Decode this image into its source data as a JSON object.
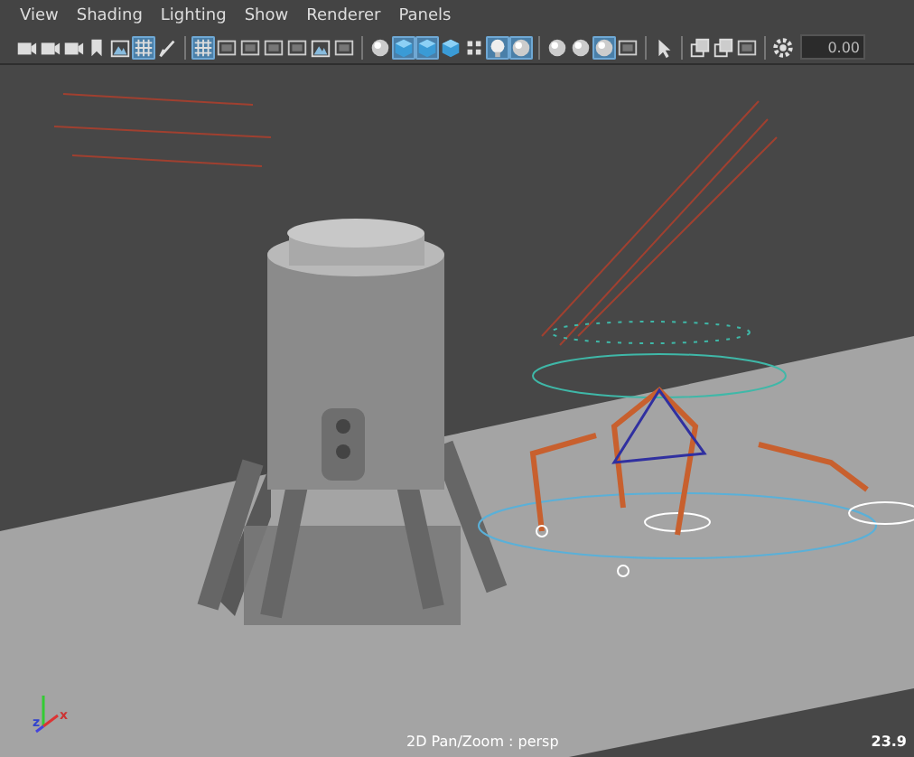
{
  "menu": [
    "View",
    "Shading",
    "Lighting",
    "Show",
    "Renderer",
    "Panels"
  ],
  "toolbar": {
    "items": [
      {
        "kind": "camera",
        "selected": false
      },
      {
        "kind": "camera",
        "selected": false
      },
      {
        "kind": "camera",
        "selected": false
      },
      {
        "kind": "bookmark",
        "selected": false
      },
      {
        "kind": "image",
        "selected": false
      },
      {
        "kind": "grid",
        "selected": true
      },
      {
        "kind": "pen",
        "selected": false
      },
      {
        "kind": "separator"
      },
      {
        "kind": "grid",
        "selected": true
      },
      {
        "kind": "frame",
        "selected": false
      },
      {
        "kind": "frame",
        "selected": false
      },
      {
        "kind": "frame",
        "selected": false
      },
      {
        "kind": "frame",
        "selected": false
      },
      {
        "kind": "image",
        "selected": false
      },
      {
        "kind": "frame",
        "selected": false
      },
      {
        "kind": "separator"
      },
      {
        "kind": "sphere",
        "selected": false
      },
      {
        "kind": "cube",
        "selected": true
      },
      {
        "kind": "cube",
        "selected": true
      },
      {
        "kind": "cube",
        "selected": false
      },
      {
        "kind": "checker",
        "selected": false
      },
      {
        "kind": "bulb",
        "selected": true
      },
      {
        "kind": "sphere",
        "selected": true
      },
      {
        "kind": "separator"
      },
      {
        "kind": "sphere",
        "selected": false
      },
      {
        "kind": "sphere",
        "selected": false
      },
      {
        "kind": "sphere",
        "selected": true
      },
      {
        "kind": "frame",
        "selected": false
      },
      {
        "kind": "separator"
      },
      {
        "kind": "cursor",
        "selected": false
      },
      {
        "kind": "separator"
      },
      {
        "kind": "windows",
        "selected": false
      },
      {
        "kind": "windows",
        "selected": false
      },
      {
        "kind": "frame",
        "selected": false
      },
      {
        "kind": "separator"
      },
      {
        "kind": "gear",
        "selected": false
      }
    ],
    "field_value": "0.00"
  },
  "viewport": {
    "axis_labels": [
      "z",
      "x"
    ],
    "camera_label": "2D Pan/Zoom : persp",
    "readout": "23.9"
  }
}
